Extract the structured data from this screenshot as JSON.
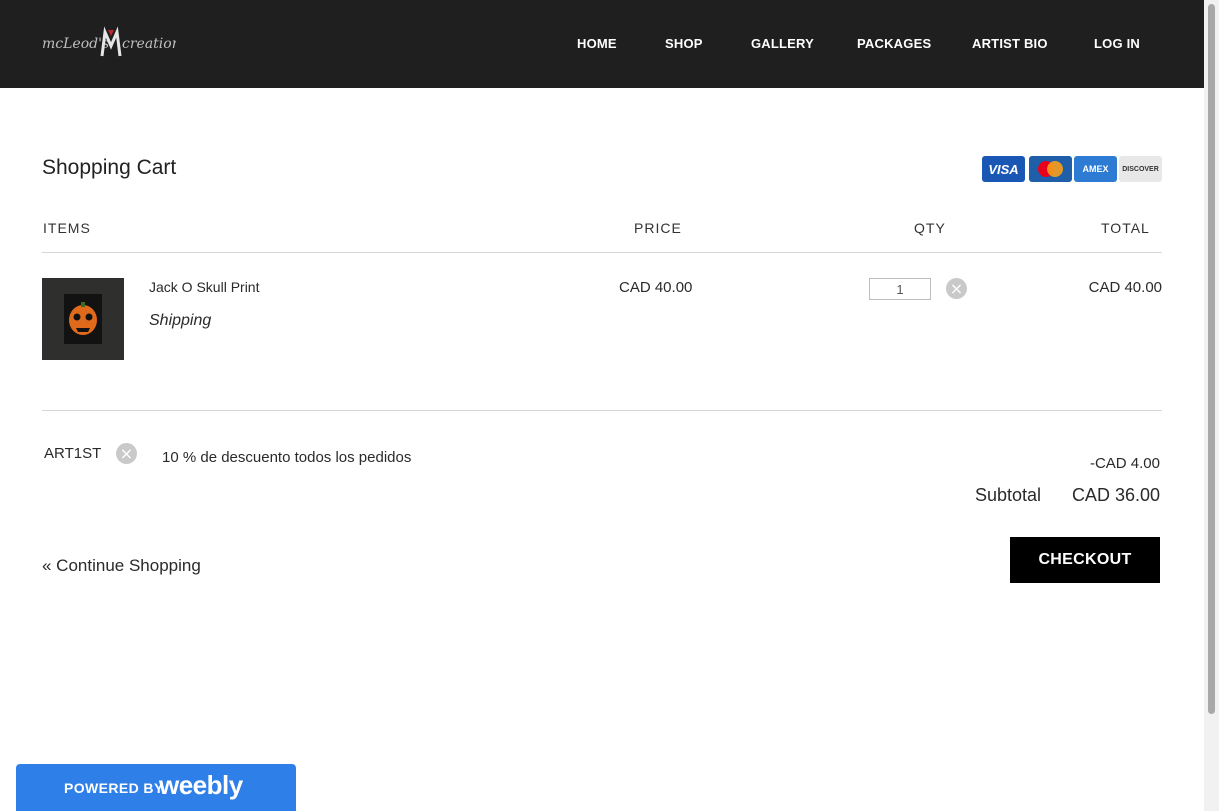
{
  "header": {
    "logo_text": "McLeod's Creations",
    "nav": [
      "HOME",
      "SHOP",
      "GALLERY",
      "PACKAGES",
      "ARTIST BIO",
      "LOG IN"
    ]
  },
  "cart": {
    "title": "Shopping Cart",
    "cards": [
      "VISA",
      "Mastercard",
      "AMEX",
      "DISCOVER"
    ],
    "columns": {
      "items": "ITEMS",
      "price": "PRICE",
      "qty": "QTY",
      "total": "TOTAL"
    },
    "line_items": [
      {
        "name": "Jack O Skull Print",
        "shipping": "Shipping",
        "price": "CAD 40.00",
        "qty": "1",
        "total": "CAD 40.00"
      }
    ],
    "coupon": {
      "code": "ART1ST",
      "description": "10 % de descuento todos los pedidos",
      "amount": "-CAD 4.00"
    },
    "subtotal_label": "Subtotal",
    "subtotal_value": "CAD 36.00",
    "continue_label": "« Continue Shopping",
    "checkout_label": "CHECKOUT"
  },
  "footer": {
    "powered_by": "POWERED BY",
    "brand": "weebly"
  },
  "colors": {
    "header_bg": "#1f1f1f",
    "checkout_bg": "#000000",
    "weebly_blue": "#2f7fe8"
  }
}
